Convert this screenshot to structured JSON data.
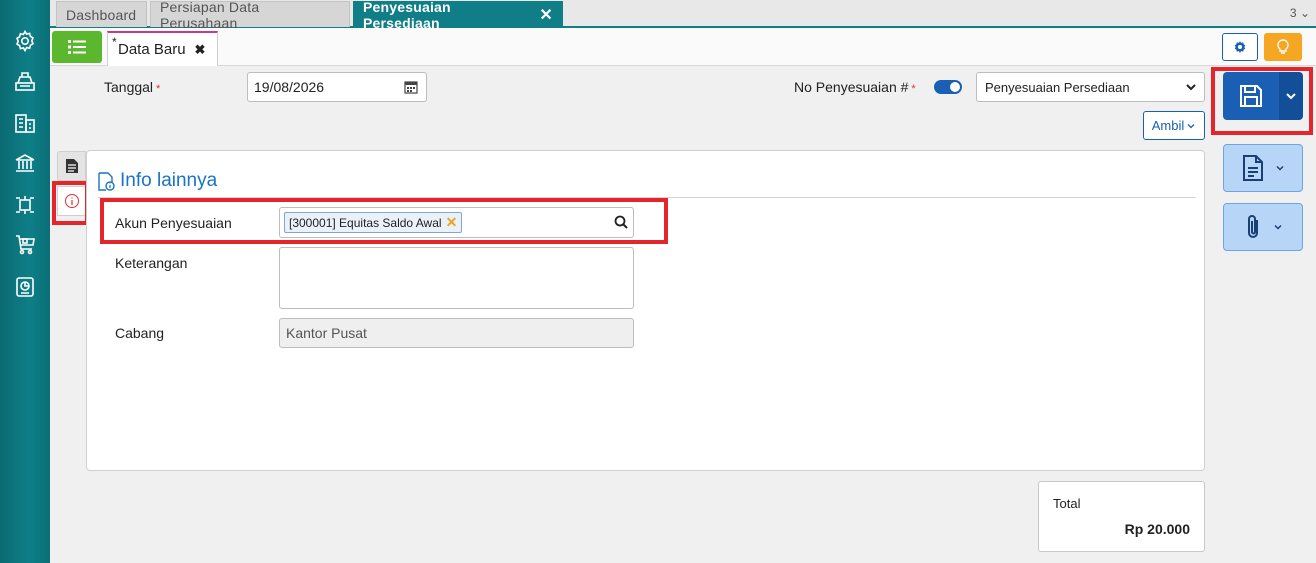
{
  "tabs": [
    {
      "label": "Dashboard"
    },
    {
      "label": "Persiapan Data Perusahaan"
    },
    {
      "label": "Penyesuaian Persediaan",
      "active": true
    }
  ],
  "tab_count": "3",
  "doc_tab": {
    "star": "*",
    "label": "Data Baru"
  },
  "form": {
    "tanggal_label": "Tanggal",
    "tanggal_value": "19/08/2026",
    "no_label": "No Penyesuaian #",
    "no_select_value": "Penyesuaian Persediaan",
    "ambil_label": "Ambil",
    "required_mark": "*"
  },
  "panel": {
    "title": "Info lainnya",
    "akun_label": "Akun Penyesuaian",
    "akun_tag": "[300001] Equitas Saldo Awal",
    "keterangan_label": "Keterangan",
    "keterangan_value": "",
    "cabang_label": "Cabang",
    "cabang_value": "Kantor Pusat"
  },
  "total": {
    "label": "Total",
    "value": "Rp 20.000"
  },
  "colors": {
    "accent": "#0f7e86",
    "primary": "#1a5fb4",
    "highlight": "#e4262c",
    "list_green": "#5bb82e",
    "bulb": "#f5a623"
  }
}
